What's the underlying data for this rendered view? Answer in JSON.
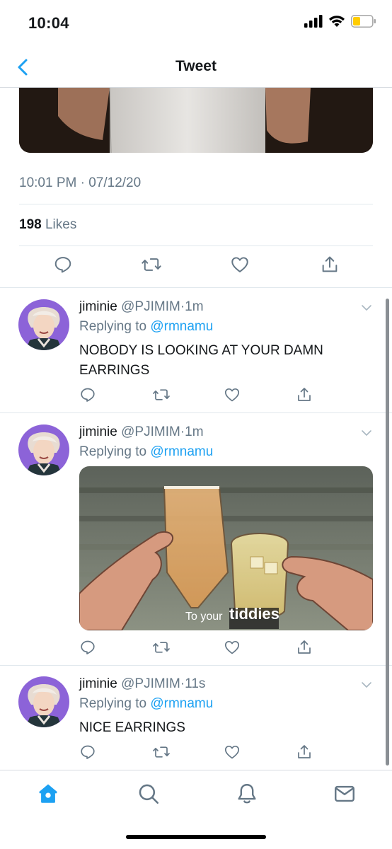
{
  "status": {
    "time": "10:04"
  },
  "header": {
    "title": "Tweet"
  },
  "tweet": {
    "timestamp": "10:01 PM · 07/12/20",
    "likes_count": "198",
    "likes_label": "Likes"
  },
  "replies": [
    {
      "name": "jiminie",
      "handle": "@PJIMIM",
      "sep": "·",
      "time": "1m",
      "replying_prefix": "Replying to",
      "replying_to": "@rmnamu",
      "text": "NOBODY IS LOOKING AT YOUR DAMN EARRINGS"
    },
    {
      "name": "jiminie",
      "handle": "@PJIMIM",
      "sep": "·",
      "time": "1m",
      "replying_prefix": "Replying to",
      "replying_to": "@rmnamu",
      "media_caption_1": "To your",
      "media_caption_2": "tiddies"
    },
    {
      "name": "jiminie",
      "handle": "@PJIMIM",
      "sep": "·",
      "time": "11s",
      "replying_prefix": "Replying to",
      "replying_to": "@rmnamu",
      "text": "NICE EARRINGS"
    }
  ],
  "icons": {
    "back": "chevron-left-icon",
    "reply": "speech-bubble-icon",
    "retweet": "retweet-icon",
    "like": "heart-icon",
    "share": "share-icon",
    "home": "home-icon",
    "search": "search-icon",
    "notifications": "bell-icon",
    "messages": "mail-icon"
  },
  "colors": {
    "accent": "#1da1f2",
    "secondary_text": "#657786",
    "icon_gray": "#657786"
  }
}
